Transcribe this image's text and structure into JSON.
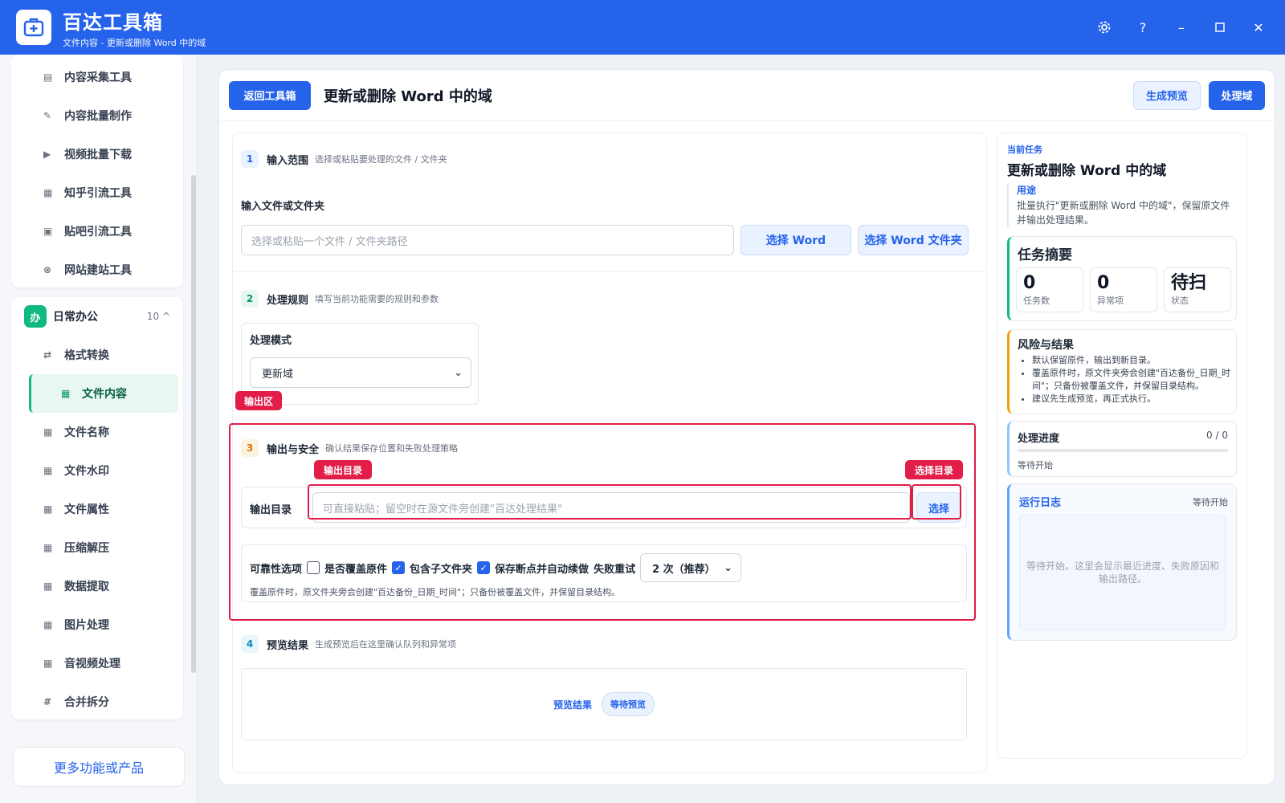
{
  "app": {
    "title": "百达工具箱",
    "subtitle": "文件内容 - 更新或删除 Word 中的域"
  },
  "window_controls": [
    "settings",
    "help",
    "minimize",
    "maximize",
    "close"
  ],
  "sidebar": {
    "top_items": [
      {
        "label": "内容采集工具",
        "icon": "collect-icon"
      },
      {
        "label": "内容批量制作",
        "icon": "edit-icon"
      },
      {
        "label": "视频批量下载",
        "icon": "video-icon"
      },
      {
        "label": "知乎引流工具",
        "icon": "zhihu-icon"
      },
      {
        "label": "贴吧引流工具",
        "icon": "tieba-icon"
      },
      {
        "label": "网站建站工具",
        "icon": "site-icon"
      }
    ],
    "group": {
      "badge": "办",
      "name": "日常办公",
      "count": "10",
      "chevron": "^"
    },
    "group_items": [
      {
        "label": "格式转换",
        "icon": "swap-icon"
      },
      {
        "label": "文件内容",
        "icon": "grid-icon",
        "active": true
      },
      {
        "label": "文件名称",
        "icon": "grid-icon"
      },
      {
        "label": "文件水印",
        "icon": "grid-icon"
      },
      {
        "label": "文件属性",
        "icon": "grid-icon"
      },
      {
        "label": "压缩解压",
        "icon": "grid-icon"
      },
      {
        "label": "数据提取",
        "icon": "grid-icon"
      },
      {
        "label": "图片处理",
        "icon": "grid-icon"
      },
      {
        "label": "音视频处理",
        "icon": "grid-icon"
      },
      {
        "label": "合并拆分",
        "icon": "hash-icon"
      }
    ],
    "more_label": "更多功能或产品"
  },
  "header": {
    "back_label": "返回工具箱",
    "title": "更新或删除 Word 中的域",
    "preview_label": "生成预览",
    "process_label": "处理域"
  },
  "section1": {
    "num": "1",
    "title": "输入范围",
    "desc": "选择或粘贴要处理的文件 / 文件夹",
    "field_label": "输入文件或文件夹",
    "placeholder": "选择或粘贴一个文件 / 文件夹路径",
    "btn_word": "选择 Word",
    "btn_folder": "选择 Word 文件夹"
  },
  "section2": {
    "num": "2",
    "title": "处理规则",
    "desc": "填写当前功能需要的规则和参数",
    "mode_label": "处理模式",
    "mode_value": "更新域"
  },
  "section3": {
    "num": "3",
    "title": "输出与安全",
    "desc": "确认结果保存位置和失败处理策略",
    "output_label": "输出目录",
    "output_placeholder": "可直接粘贴；留空时在源文件旁创建\"百达处理结果\"",
    "choose_label": "选择",
    "reliability_label": "可靠性选项",
    "opt_overwrite": "是否覆盖原件",
    "opt_subfolder": "包含子文件夹",
    "opt_resume": "保存断点并自动续做",
    "retry_label": "失败重试",
    "retry_value": "2 次（推荐）",
    "note": "覆盖原件时，原文件夹旁会创建\"百达备份_日期_时间\"；只备份被覆盖文件，并保留目录结构。",
    "options": {
      "overwrite": false,
      "subfolder": true,
      "resume": true
    }
  },
  "annotations": {
    "output_area": "输出区",
    "output_dir": "输出目录",
    "choose_dir": "选择目录"
  },
  "section4": {
    "num": "4",
    "title": "预览结果",
    "desc": "生成预览后在这里确认队列和异常项",
    "result_label": "预览结果",
    "status_badge": "等待预览"
  },
  "right": {
    "current_task_label": "当前任务",
    "task_title": "更新或删除 Word 中的域",
    "purpose_label": "用途",
    "purpose_text": "批量执行\"更新或删除 Word 中的域\"，保留原文件并输出处理结果。",
    "summary_title": "任务摘要",
    "stats": [
      {
        "value": "0",
        "label": "任务数"
      },
      {
        "value": "0",
        "label": "异常项"
      },
      {
        "value": "待扫",
        "label": "状态"
      }
    ],
    "risk_title": "风险与结果",
    "risk_items": [
      "默认保留原件，输出到新目录。",
      "覆盖原件时，原文件夹旁会创建\"百达备份_日期_时间\"；只备份被覆盖文件，并保留目录结构。",
      "建议先生成预览，再正式执行。"
    ],
    "progress_title": "处理进度",
    "progress_count": "0 / 0",
    "progress_value": 0,
    "progress_status": "等待开始",
    "log_title": "运行日志",
    "log_status": "等待开始",
    "log_placeholder": "等待开始。这里会显示最近进度、失败原因和输出路径。"
  },
  "colors": {
    "brand": "#2563eb",
    "accent_green": "#10b981",
    "highlight": "#e11d48"
  }
}
